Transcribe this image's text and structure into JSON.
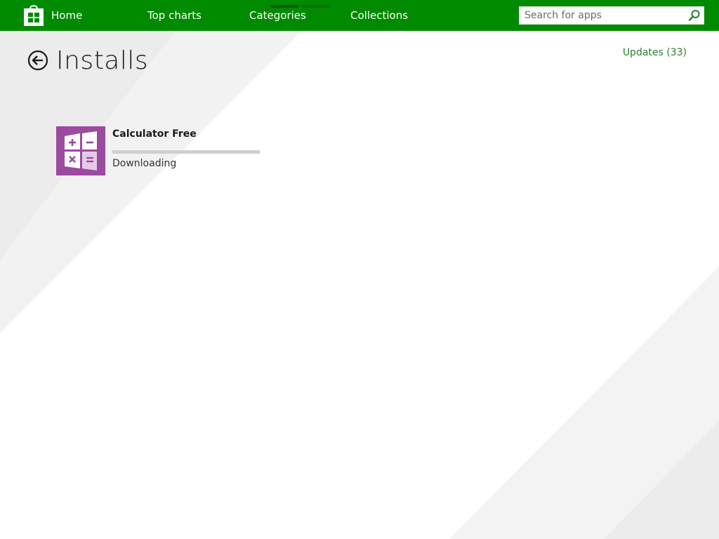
{
  "colors": {
    "topbar": "#008a00",
    "nav_indicator": "#045b04",
    "accent_link": "#2d7d2d",
    "app_tile": "#9b4a9f"
  },
  "topbar": {
    "logo_icon": "store-bag-icon",
    "nav": [
      {
        "label": "Home"
      },
      {
        "label": "Top charts"
      },
      {
        "label": "Categories"
      },
      {
        "label": "Collections"
      }
    ],
    "search": {
      "placeholder": "Search for apps",
      "value": "",
      "icon": "search-icon"
    }
  },
  "page": {
    "back_icon": "back-arrow-icon",
    "title": "Installs",
    "updates_link": "Updates (33)"
  },
  "installs": [
    {
      "name": "Calculator Free",
      "status": "Downloading",
      "progress": 0,
      "icon": "calculator-icon"
    }
  ]
}
